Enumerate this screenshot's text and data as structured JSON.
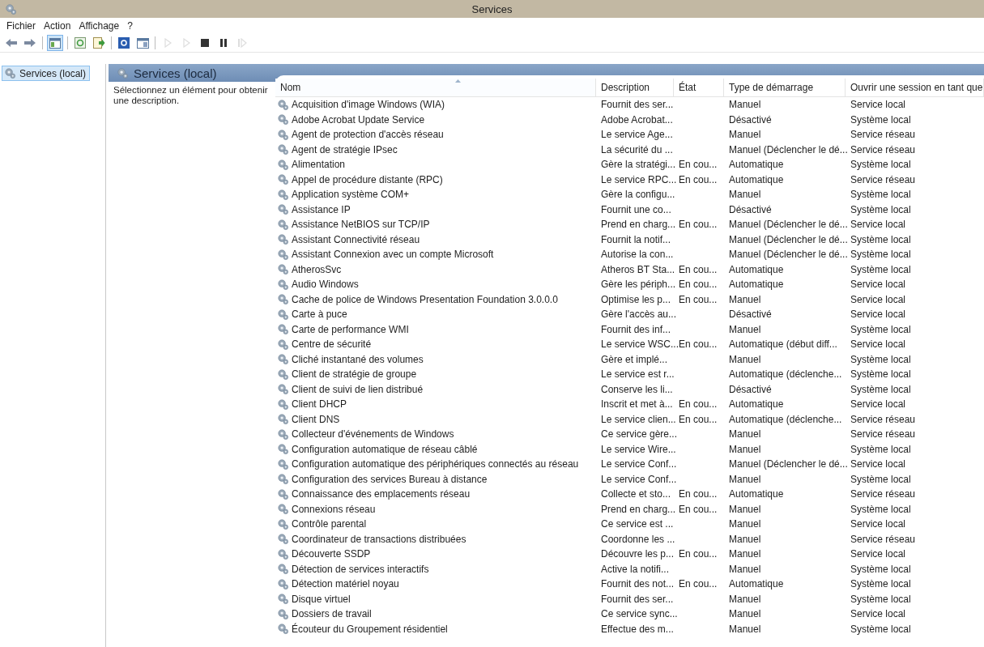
{
  "window": {
    "title": "Services"
  },
  "menu": [
    "Fichier",
    "Action",
    "Affichage",
    "?"
  ],
  "toolbar": [
    {
      "kind": "back",
      "selected": false,
      "disabled": false
    },
    {
      "kind": "forward",
      "selected": false,
      "disabled": false
    },
    {
      "kind": "separator"
    },
    {
      "kind": "tree",
      "selected": true,
      "disabled": false
    },
    {
      "kind": "separator"
    },
    {
      "kind": "refresh",
      "selected": false,
      "disabled": false
    },
    {
      "kind": "export",
      "selected": false,
      "disabled": false
    },
    {
      "kind": "separator"
    },
    {
      "kind": "help",
      "selected": false,
      "disabled": false
    },
    {
      "kind": "view",
      "selected": false,
      "disabled": false
    },
    {
      "kind": "separator"
    },
    {
      "kind": "play",
      "selected": false,
      "disabled": true
    },
    {
      "kind": "play",
      "selected": false,
      "disabled": true
    },
    {
      "kind": "stop",
      "selected": false,
      "disabled": false
    },
    {
      "kind": "pause",
      "selected": false,
      "disabled": false
    },
    {
      "kind": "resume",
      "selected": false,
      "disabled": true
    }
  ],
  "tree": [
    {
      "label": "Services (local)",
      "selected": true
    }
  ],
  "pane": {
    "title": "Services (local)",
    "description": "Sélectionnez un élément pour obtenir une description."
  },
  "table": {
    "columns": [
      {
        "label": "Nom",
        "sorted": true
      },
      {
        "label": "Description",
        "sorted": false
      },
      {
        "label": "État",
        "sorted": false
      },
      {
        "label": "Type de démarrage",
        "sorted": false
      },
      {
        "label": "Ouvrir une session en tant que",
        "sorted": false
      }
    ],
    "rows": [
      [
        "Acquisition d'image Windows (WIA)",
        "Fournit des ser...",
        "",
        "Manuel",
        "Service local"
      ],
      [
        "Adobe Acrobat Update Service",
        "Adobe Acrobat...",
        "",
        "Désactivé",
        "Système local"
      ],
      [
        "Agent de protection d'accès réseau",
        "Le service Age...",
        "",
        "Manuel",
        "Service réseau"
      ],
      [
        "Agent de stratégie IPsec",
        "La sécurité du ...",
        "",
        "Manuel (Déclencher le dé...",
        "Service réseau"
      ],
      [
        "Alimentation",
        "Gère la stratégi...",
        "En cou...",
        "Automatique",
        "Système local"
      ],
      [
        "Appel de procédure distante (RPC)",
        "Le service RPC...",
        "En cou...",
        "Automatique",
        "Service réseau"
      ],
      [
        "Application système COM+",
        "Gère la configu...",
        "",
        "Manuel",
        "Système local"
      ],
      [
        "Assistance IP",
        "Fournit une co...",
        "",
        "Désactivé",
        "Système local"
      ],
      [
        "Assistance NetBIOS sur TCP/IP",
        "Prend en charg...",
        "En cou...",
        "Manuel (Déclencher le dé...",
        "Service local"
      ],
      [
        "Assistant Connectivité réseau",
        "Fournit la notif...",
        "",
        "Manuel (Déclencher le dé...",
        "Système local"
      ],
      [
        "Assistant Connexion avec un compte Microsoft",
        "Autorise la con...",
        "",
        "Manuel (Déclencher le dé...",
        "Système local"
      ],
      [
        "AtherosSvc",
        "Atheros BT Sta...",
        "En cou...",
        "Automatique",
        "Système local"
      ],
      [
        "Audio Windows",
        "Gère les périph...",
        "En cou...",
        "Automatique",
        "Service local"
      ],
      [
        "Cache de police de Windows Presentation Foundation 3.0.0.0",
        "Optimise les p...",
        "En cou...",
        "Manuel",
        "Service local"
      ],
      [
        "Carte à puce",
        "Gère l'accès au...",
        "",
        "Désactivé",
        "Service local"
      ],
      [
        "Carte de performance WMI",
        "Fournit des inf...",
        "",
        "Manuel",
        "Système local"
      ],
      [
        "Centre de sécurité",
        "Le service WSC...",
        "En cou...",
        "Automatique (début diff...",
        "Service local"
      ],
      [
        "Cliché instantané des volumes",
        "Gère et implé...",
        "",
        "Manuel",
        "Système local"
      ],
      [
        "Client de stratégie de groupe",
        "Le service est r...",
        "",
        "Automatique (déclenche...",
        "Système local"
      ],
      [
        "Client de suivi de lien distribué",
        "Conserve les li...",
        "",
        "Désactivé",
        "Système local"
      ],
      [
        "Client DHCP",
        "Inscrit et met à...",
        "En cou...",
        "Automatique",
        "Service local"
      ],
      [
        "Client DNS",
        "Le service clien...",
        "En cou...",
        "Automatique (déclenche...",
        "Service réseau"
      ],
      [
        "Collecteur d'événements de Windows",
        "Ce service gère...",
        "",
        "Manuel",
        "Service réseau"
      ],
      [
        "Configuration automatique de réseau câblé",
        "Le service Wire...",
        "",
        "Manuel",
        "Système local"
      ],
      [
        "Configuration automatique des périphériques connectés au réseau",
        "Le service Conf...",
        "",
        "Manuel (Déclencher le dé...",
        "Service local"
      ],
      [
        "Configuration des services Bureau à distance",
        "Le service Conf...",
        "",
        "Manuel",
        "Système local"
      ],
      [
        "Connaissance des emplacements réseau",
        "Collecte et sto...",
        "En cou...",
        "Automatique",
        "Service réseau"
      ],
      [
        "Connexions réseau",
        "Prend en charg...",
        "En cou...",
        "Manuel",
        "Système local"
      ],
      [
        "Contrôle parental",
        "Ce service est ...",
        "",
        "Manuel",
        "Service local"
      ],
      [
        "Coordinateur de transactions distribuées",
        "Coordonne les ...",
        "",
        "Manuel",
        "Service réseau"
      ],
      [
        "Découverte SSDP",
        "Découvre les p...",
        "En cou...",
        "Manuel",
        "Service local"
      ],
      [
        "Détection de services interactifs",
        "Active la notifi...",
        "",
        "Manuel",
        "Système local"
      ],
      [
        "Détection matériel noyau",
        "Fournit des not...",
        "En cou...",
        "Automatique",
        "Système local"
      ],
      [
        "Disque virtuel",
        "Fournit des ser...",
        "",
        "Manuel",
        "Système local"
      ],
      [
        "Dossiers de travail",
        "Ce service sync...",
        "",
        "Manuel",
        "Service local"
      ],
      [
        "Écouteur du Groupement résidentiel",
        "Effectue des m...",
        "",
        "Manuel",
        "Système local"
      ]
    ]
  }
}
